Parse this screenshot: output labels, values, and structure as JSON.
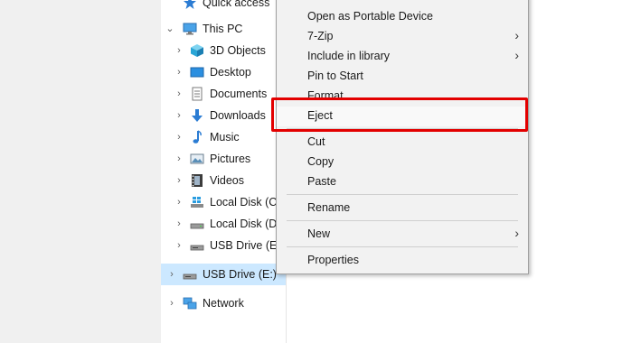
{
  "nav": {
    "quick_access": "Quick access",
    "this_pc": "This PC",
    "items": [
      "3D Objects",
      "Desktop",
      "Documents",
      "Downloads",
      "Music",
      "Pictures",
      "Videos",
      "Local Disk (C:)",
      "Local Disk (D:)",
      "USB Drive (E:)"
    ],
    "selected_drive": "USB Drive (E:)",
    "network": "Network"
  },
  "context_menu": {
    "open_portable": "Open as Portable Device",
    "seven_zip": "7-Zip",
    "include_library": "Include in library",
    "pin_start": "Pin to Start",
    "format": "Format...",
    "eject": "Eject",
    "cut": "Cut",
    "copy": "Copy",
    "paste": "Paste",
    "rename": "Rename",
    "new": "New",
    "properties": "Properties",
    "submenu_arrow": "›"
  },
  "colors": {
    "highlight_border": "#e30000",
    "selected_bg": "#cce8ff",
    "menu_bg": "#f2f2f2"
  }
}
